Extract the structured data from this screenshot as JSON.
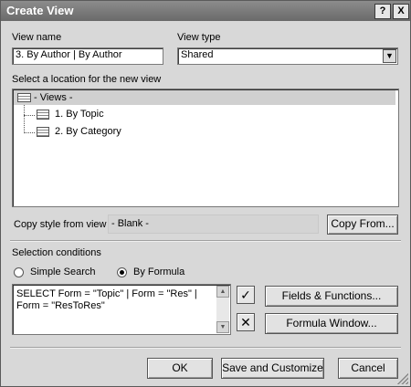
{
  "window": {
    "title": "Create View",
    "help_glyph": "?",
    "close_glyph": "X"
  },
  "view_name": {
    "label": "View name",
    "value": "3. By Author | By Author"
  },
  "view_type": {
    "label": "View type",
    "value": "Shared"
  },
  "location": {
    "label": "Select a location for the new view",
    "root": "- Views -",
    "items": [
      "1. By Topic",
      "2. By Category"
    ]
  },
  "copy_style": {
    "label": "Copy style from view",
    "value": "- Blank -",
    "button": "Copy From..."
  },
  "selection": {
    "label": "Selection conditions",
    "options": [
      "Simple Search",
      "By Formula"
    ],
    "selected": "By Formula",
    "formula": "SELECT Form = \"Topic\" | Form = \"Res\" | Form = \"ResToRes\""
  },
  "formula_buttons": {
    "fields": "Fields & Functions...",
    "window": "Formula Window..."
  },
  "footer": {
    "ok": "OK",
    "save": "Save and Customize",
    "cancel": "Cancel"
  },
  "icons": {
    "check": "checkmark-icon",
    "cross": "close-icon"
  }
}
